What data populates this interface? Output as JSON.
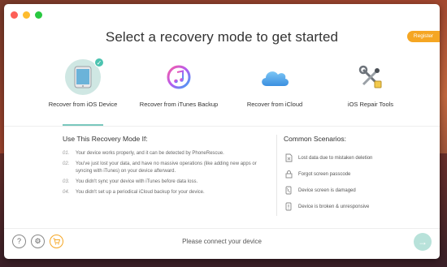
{
  "title": "Select a recovery mode to get started",
  "register_label": "Register",
  "modes": [
    {
      "label": "Recover from iOS Device",
      "icon": "ipad-icon",
      "active": true
    },
    {
      "label": "Recover from iTunes Backup",
      "icon": "itunes-icon",
      "active": false
    },
    {
      "label": "Recover from iCloud",
      "icon": "icloud-icon",
      "active": false
    },
    {
      "label": "iOS Repair Tools",
      "icon": "repair-tools-icon",
      "active": false
    }
  ],
  "left": {
    "title": "Use This Recovery Mode If:",
    "rules": [
      {
        "num": "01.",
        "text": "Your device works properly, and it can be detected by PhoneRescue."
      },
      {
        "num": "02.",
        "text": "You've just lost your data, and have no massive operations (like adding new apps or syncing with iTunes) on your device afterward."
      },
      {
        "num": "03.",
        "text": "You didn't sync your device with iTunes before data loss."
      },
      {
        "num": "04.",
        "text": "You didn't set up a periodical iCloud backup for your device."
      }
    ]
  },
  "right": {
    "title": "Common Scenarios:",
    "items": [
      {
        "text": "Lost data due to mistaken deletion",
        "icon": "deleted-file-icon"
      },
      {
        "text": "Forgot screen passcode",
        "icon": "lock-icon"
      },
      {
        "text": "Device screen is damaged",
        "icon": "damaged-phone-icon"
      },
      {
        "text": "Device is broken & unresponsive",
        "icon": "broken-phone-icon"
      }
    ]
  },
  "footer": {
    "status": "Please connect your device",
    "help_glyph": "?",
    "settings_glyph": "⚙",
    "cart_glyph": "🛒",
    "next_glyph": "→"
  },
  "colors": {
    "accent": "#4cc3b0",
    "register": "#f5a623"
  }
}
